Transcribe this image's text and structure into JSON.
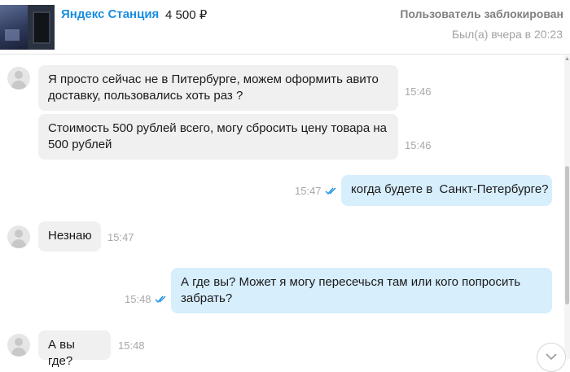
{
  "header": {
    "item_title": "Яндекс Станция",
    "item_price": "4 500 ₽",
    "user_status": "Пользователь заблокирован",
    "last_seen": "Был(а) вчера в 20:23"
  },
  "messages": [
    {
      "direction": "in",
      "text_lines": [
        "Я просто сейчас не в Питербурге, можем оформить авито",
        "доставку, пользовались хоть раз ?"
      ],
      "time": "15:46"
    },
    {
      "direction": "in",
      "text_lines": [
        "Стоимость 500 рублей всего, могу сбросить цену товара на",
        "500 рублей"
      ],
      "time": "15:46"
    },
    {
      "direction": "out",
      "text_lines": [
        "когда будете в  Санкт-Петербурге?"
      ],
      "time": "15:47",
      "read": true
    },
    {
      "direction": "in",
      "text_lines": [
        "Незнаю"
      ],
      "time": "15:47"
    },
    {
      "direction": "out",
      "text_lines": [
        "А где вы? Может я могу пересечься там или кого попросить",
        "забрать?"
      ],
      "time": "15:48",
      "read": true
    },
    {
      "direction": "in",
      "text_lines": [
        "А вы где?"
      ],
      "time": "15:48"
    }
  ],
  "icons": {
    "avatar": "user-avatar-icon",
    "read_receipt": "double-check-icon",
    "scroll_down": "chevron-down-icon"
  },
  "colors": {
    "link": "#1a8ee1",
    "incoming_bubble": "#f0f0f0",
    "outgoing_bubble": "#d7eefd",
    "read_check": "#1a8ee1"
  }
}
